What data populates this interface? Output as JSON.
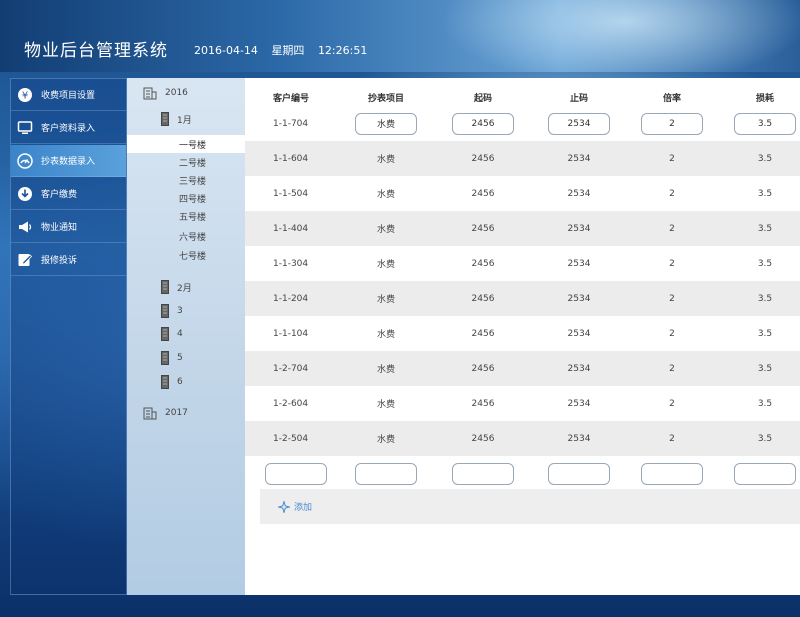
{
  "header": {
    "title": "物业后台管理系统",
    "date": "2016-04-14",
    "weekday": "星期四",
    "time": "12:26:51"
  },
  "sidebar": {
    "items": [
      {
        "label": "收费项目设置",
        "icon": "yen-icon"
      },
      {
        "label": "客户资料录入",
        "icon": "monitor-icon"
      },
      {
        "label": "抄表数据录入",
        "icon": "gauge-icon",
        "active": true
      },
      {
        "label": "客户缴费",
        "icon": "download-icon"
      },
      {
        "label": "物业通知",
        "icon": "megaphone-icon"
      },
      {
        "label": "报修投诉",
        "icon": "edit-icon"
      }
    ]
  },
  "tree": {
    "year1": "2016",
    "month1": "1月",
    "buildings": [
      "一号楼",
      "二号楼",
      "三号楼",
      "四号楼",
      "五号楼",
      "六号楼",
      "七号楼"
    ],
    "months": [
      "2月",
      "3",
      "4",
      "5",
      "6"
    ],
    "year2": "2017"
  },
  "table": {
    "headers": [
      "客户编号",
      "抄表项目",
      "起码",
      "止码",
      "倍率",
      "损耗"
    ],
    "rows": [
      [
        "1-1-704",
        "水费",
        "2456",
        "2534",
        "2",
        "3.5"
      ],
      [
        "1-1-604",
        "水费",
        "2456",
        "2534",
        "2",
        "3.5"
      ],
      [
        "1-1-504",
        "水费",
        "2456",
        "2534",
        "2",
        "3.5"
      ],
      [
        "1-1-404",
        "水费",
        "2456",
        "2534",
        "2",
        "3.5"
      ],
      [
        "1-1-304",
        "水费",
        "2456",
        "2534",
        "2",
        "3.5"
      ],
      [
        "1-1-204",
        "水费",
        "2456",
        "2534",
        "2",
        "3.5"
      ],
      [
        "1-1-104",
        "水费",
        "2456",
        "2534",
        "2",
        "3.5"
      ],
      [
        "1-2-704",
        "水费",
        "2456",
        "2534",
        "2",
        "3.5"
      ],
      [
        "1-2-604",
        "水费",
        "2456",
        "2534",
        "2",
        "3.5"
      ],
      [
        "1-2-504",
        "水费",
        "2456",
        "2534",
        "2",
        "3.5"
      ]
    ],
    "add_label": "添加"
  }
}
